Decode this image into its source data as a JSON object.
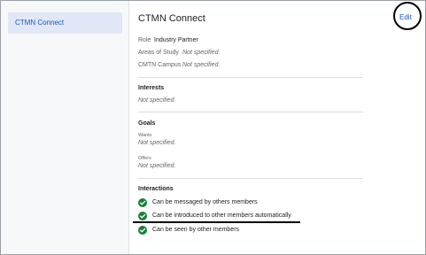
{
  "sidebar": {
    "items": [
      {
        "label": "CTMN Connect"
      }
    ]
  },
  "header": {
    "title": "CTMN Connect",
    "edit_label": "Edit"
  },
  "profile": {
    "role_label": "Role",
    "role_value": "Industry Partner",
    "areas_label": "Areas of Study",
    "areas_value": "Not specified.",
    "campus_label": "CMTN Campus",
    "campus_value": "Not specified."
  },
  "interests": {
    "heading": "Interests",
    "value": "Not specified."
  },
  "goals": {
    "heading": "Goals",
    "wants_label": "Wants",
    "wants_value": "Not specified.",
    "offers_label": "Offers",
    "offers_value": "Not specified."
  },
  "interactions": {
    "heading": "Interactions",
    "items": [
      {
        "label": "Can be messaged by others members"
      },
      {
        "label": "Can be introduced to other members automatically"
      },
      {
        "label": "Can be seen by other members"
      }
    ]
  },
  "colors": {
    "accent": "#1a56c4",
    "check_green": "#188038",
    "sidebar_selected": "#e1e7f6"
  }
}
